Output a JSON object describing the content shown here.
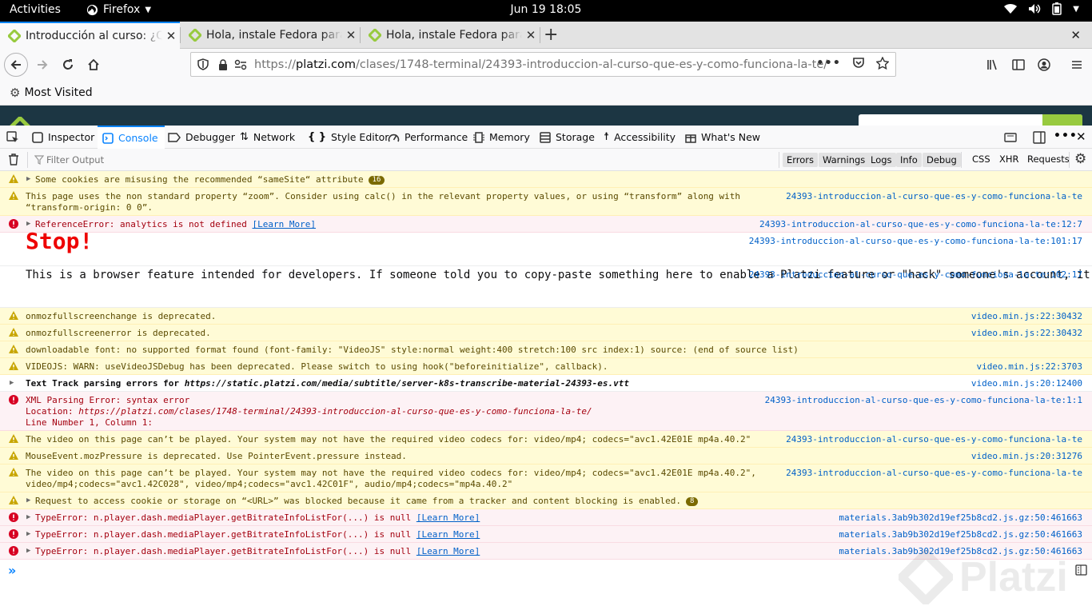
{
  "topbar": {
    "activities": "Activities",
    "app": "Firefox",
    "clock": "Jun 19  18:05"
  },
  "tabs": [
    {
      "label": "Introducción al curso: ¿Qué es y cómo funciona la terminal?",
      "active": true
    },
    {
      "label": "Hola, instale Fedora para",
      "active": false
    },
    {
      "label": "Hola, instale Fedora para",
      "active": false
    }
  ],
  "nav": {
    "url_scheme": "https://",
    "url_host": "platzi.com",
    "url_path": "/clases/1748-terminal/24393-introduccion-al-curso-que-es-y-como-funciona-la-te/",
    "more": "•••"
  },
  "bookmarks": {
    "most_visited": "Most Visited"
  },
  "devtools": {
    "tabs": [
      "Inspector",
      "Console",
      "Debugger",
      "Network",
      "Style Editor",
      "Performance",
      "Memory",
      "Storage",
      "Accessibility",
      "What's New"
    ],
    "selected_tab": "Console",
    "filter_placeholder": "Filter Output",
    "levels": [
      "Errors",
      "Warnings",
      "Logs",
      "Info",
      "Debug"
    ],
    "types": [
      "CSS",
      "XHR",
      "Requests"
    ]
  },
  "messages": [
    {
      "level": "warn",
      "text": "Some cookies are misusing the recommended “sameSite“ attribute",
      "badge": "16",
      "src": ""
    },
    {
      "level": "warn",
      "text": "This page uses the non standard property “zoom”. Consider using calc() in the relevant property values, or using “transform” along with\n“transform-origin: 0 0”.",
      "src": "24393-introduccion-al-curso-que-es-y-como-funciona-la-te"
    },
    {
      "level": "err",
      "text": "ReferenceError: analytics is not defined",
      "learn": "[Learn More]",
      "src": "24393-introduccion-al-curso-que-es-y-como-funciona-la-te:12:7"
    },
    {
      "level": "log",
      "text": "Stop!",
      "src": "24393-introduccion-al-curso-que-es-y-como-funciona-la-te:101:17"
    },
    {
      "level": "log",
      "text": "This is a browser feature intended for developers. If someone told you to copy-paste something here to enable a Platzi feature or \"hack\" someone's account, it is a scam and will give them access to your Platzi account.",
      "src": "24393-introduccion-al-curso-que-es-y-como-funciona-la-te:102:17"
    },
    {
      "level": "warn",
      "text": "onmozfullscreenchange is deprecated.",
      "src": "video.min.js:22:30432"
    },
    {
      "level": "warn",
      "text": "onmozfullscreenerror is deprecated.",
      "src": "video.min.js:22:30432"
    },
    {
      "level": "warn",
      "text": "downloadable font: no supported format found (font-family: \"VideoJS\" style:normal weight:400 stretch:100 src index:1) source: (end of source list)",
      "src": ""
    },
    {
      "level": "warn",
      "text": "VIDEOJS: WARN: useVideoJSDebug has been deprecated. Please switch to using hook(\"beforeinitialize\", callback).",
      "src": "video.min.js:22:3703"
    },
    {
      "level": "log",
      "text_prefix": "Text Track parsing errors for ",
      "text_url": "https://static.platzi.com/media/subtitle/server-k8s-transcribe-material-24393-es.vtt",
      "src": "video.min.js:20:12400"
    },
    {
      "level": "err",
      "line1": "XML Parsing Error: syntax error",
      "line2_prefix": "Location: ",
      "line2_url": "https://platzi.com/clases/1748-terminal/24393-introduccion-al-curso-que-es-y-como-funciona-la-te/",
      "line3": "Line Number 1, Column 1:",
      "src": "24393-introduccion-al-curso-que-es-y-como-funciona-la-te:1:1"
    },
    {
      "level": "warn",
      "text": "The video on this page can’t be played. Your system may not have the required video codecs for: video/mp4; codecs=\"avc1.42E01E mp4a.40.2\"",
      "src": "24393-introduccion-al-curso-que-es-y-como-funciona-la-te"
    },
    {
      "level": "warn",
      "text": "MouseEvent.mozPressure is deprecated. Use PointerEvent.pressure instead.",
      "src": "video.min.js:20:31276"
    },
    {
      "level": "warn",
      "text": "The video on this page can’t be played. Your system may not have the required video codecs for: video/mp4; codecs=\"avc1.42E01E mp4a.40.2\",\nvideo/mp4;codecs=\"avc1.42C028\", video/mp4;codecs=\"avc1.42C01F\", audio/mp4;codecs=\"mp4a.40.2\"",
      "src": "24393-introduccion-al-curso-que-es-y-como-funciona-la-te"
    },
    {
      "level": "warn",
      "text": "Request to access cookie or storage on “<URL>” was blocked because it came from a tracker and content blocking is enabled.",
      "badge": "8",
      "src": ""
    },
    {
      "level": "err",
      "text": "TypeError: n.player.dash.mediaPlayer.getBitrateInfoListFor(...) is null",
      "learn": "[Learn More]",
      "src": "materials.3ab9b302d19ef25b8cd2.js.gz:50:461663"
    },
    {
      "level": "err",
      "text": "TypeError: n.player.dash.mediaPlayer.getBitrateInfoListFor(...) is null",
      "learn": "[Learn More]",
      "src": "materials.3ab9b302d19ef25b8cd2.js.gz:50:461663"
    },
    {
      "level": "err",
      "text": "TypeError: n.player.dash.mediaPlayer.getBitrateInfoListFor(...) is null",
      "learn": "[Learn More]",
      "src": "materials.3ab9b302d19ef25b8cd2.js.gz:50:461663"
    }
  ],
  "watermark": "Platzi",
  "colors": {
    "accent": "#0a84ff",
    "warn_bg": "#fffbd6",
    "err_bg": "#fdf2f5",
    "platzi_green": "#98ca3f"
  }
}
